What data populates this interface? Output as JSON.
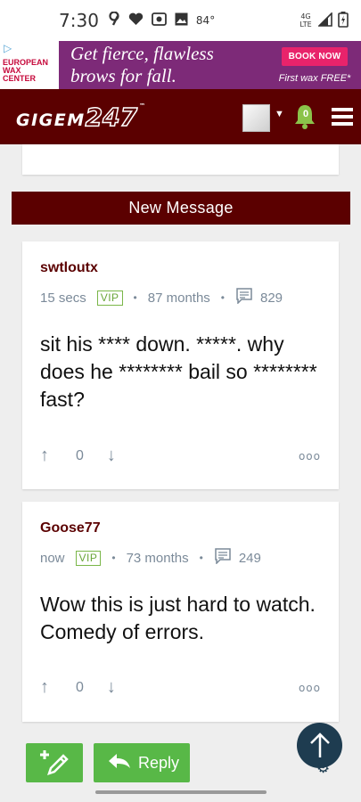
{
  "status_bar": {
    "time": "7:30",
    "temperature": "84°",
    "network": "4G LTE",
    "icons": [
      "sports-icon",
      "heart-icon",
      "radio-icon",
      "image-icon",
      "wifi-icon",
      "signal-icon",
      "battery-icon"
    ]
  },
  "ad": {
    "logo_lines": [
      "EUROPEAN",
      "WAX",
      "CENTER"
    ],
    "headline_line1": "Get fierce, flawless",
    "headline_line2": "brows for fall.",
    "cta_label": "BOOK NOW",
    "subtext": "First wax FREE*",
    "colors": {
      "background": "#7d2a78",
      "button": "#e8236b",
      "logo_text": "#c6093b"
    }
  },
  "header": {
    "logo_text": "GIGEM",
    "logo_number": "247",
    "logo_tm": "™",
    "notification_count": "0",
    "colors": {
      "background": "#5b0000",
      "bell": "#8bc34a"
    }
  },
  "new_message_label": "New Message",
  "posts": [
    {
      "username": "swtloutx",
      "time": "15 secs",
      "badge": "VIP",
      "tenure": "87 months",
      "post_count": "829",
      "body": "sit his **** down. *****. why does he ******** bail so ******** fast?",
      "votes": "0"
    },
    {
      "username": "Goose77",
      "time": "now",
      "badge": "VIP",
      "tenure": "73 months",
      "post_count": "249",
      "body": "Wow this is just hard to watch. Comedy of errors.",
      "votes": "0"
    }
  ],
  "bottom": {
    "reply_label": "Reply",
    "colors": {
      "button": "#58b847",
      "scroll_top": "#1e3c50"
    }
  }
}
